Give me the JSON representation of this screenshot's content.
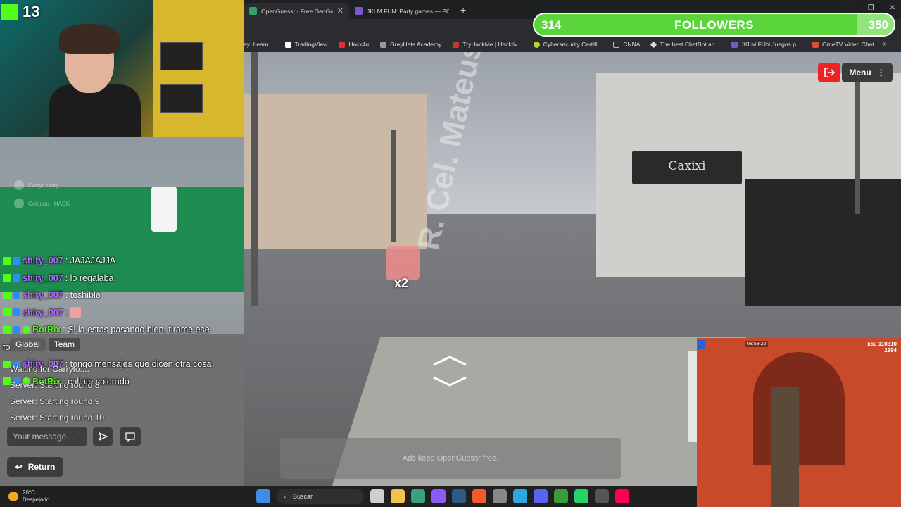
{
  "browser": {
    "tabs": [
      {
        "label": "OpenGuessr - Free GeoGuessr A",
        "active": true
      },
      {
        "label": "JKLM.FUN: Party games — PC & Sma",
        "active": false
      }
    ],
    "bookmarks": [
      {
        "label": "ey: Learn...",
        "color": "#777777"
      },
      {
        "label": "TradingView",
        "color": "#ffffff"
      },
      {
        "label": "Hack4u",
        "color": "#e03030"
      },
      {
        "label": "GreyHats Academy",
        "color": "#999999"
      },
      {
        "label": "TryHackMe | Hacktiv...",
        "color": "#c0392b"
      },
      {
        "label": "Cybersecurity Certifi...",
        "color": "#b5d334"
      },
      {
        "label": "CNNA",
        "color": "#888888"
      },
      {
        "label": "The best ChatBot an...",
        "color": "#dddddd"
      },
      {
        "label": "JKLM.FUN Juegos p...",
        "color": "#7a57d1"
      },
      {
        "label": "OmeTV Video Chat...",
        "color": "#e04a3a"
      }
    ]
  },
  "stream": {
    "viewer_count": "13",
    "goal": {
      "current": "314",
      "label": "FOLLOWERS",
      "target": "350",
      "progress": 0.897
    }
  },
  "game": {
    "menu_label": "Menu",
    "street_name": "R. Cel. Mateus Con",
    "multiplier": "x2",
    "shop_name": "Caxixi",
    "ads_text": "Ads keep OpenGuessr free.",
    "faded_players": [
      "Carrytoquiry",
      "Colouuu · HACK"
    ],
    "chat_tabs": [
      "Global",
      "Team"
    ],
    "chat_log": [
      "Waiting for Carryto....",
      "Server: Starting round 8.",
      "Server: Starting round 9.",
      "Server: Starting round 10."
    ],
    "chat_placeholder": "Your message...",
    "return_label": "Return"
  },
  "kick_chat": [
    {
      "user": "shiry_007",
      "text": ": JAJAJAJJA",
      "style": "purple",
      "emote": false
    },
    {
      "user": "shiry_007",
      "text": ": lo regalaba",
      "style": "purple",
      "emote": false
    },
    {
      "user": "shiry_007",
      "text": ": teshible",
      "style": "purple",
      "emote": false
    },
    {
      "user": "shiry_007",
      "text": ":",
      "style": "purple",
      "emote": true
    },
    {
      "user": "BotRix",
      "text": ": Si la estas pasando bien, tirame ese",
      "style": "green",
      "emote": false
    },
    {
      "user": "",
      "text": "follow :)",
      "style": "cont",
      "emote": false
    },
    {
      "user": "shiry_007",
      "text": ": tengo mensajes que dicen otra cosa",
      "style": "purple",
      "emote": false
    },
    {
      "user": "BotRix",
      "text": ": callate colorado",
      "style": "green",
      "emote": false
    }
  ],
  "subway": {
    "time": "08:59:22",
    "multiplier": "x60",
    "score": "110310",
    "coins": "2994"
  },
  "taskbar": {
    "temperature": "20°C",
    "condition": "Despejado",
    "search_placeholder": "Buscar"
  },
  "colors": {
    "kick_green": "#53fc18",
    "goal_green": "#5bd63a",
    "exit_red": "#e22222",
    "username_purple": "#b36bff"
  }
}
